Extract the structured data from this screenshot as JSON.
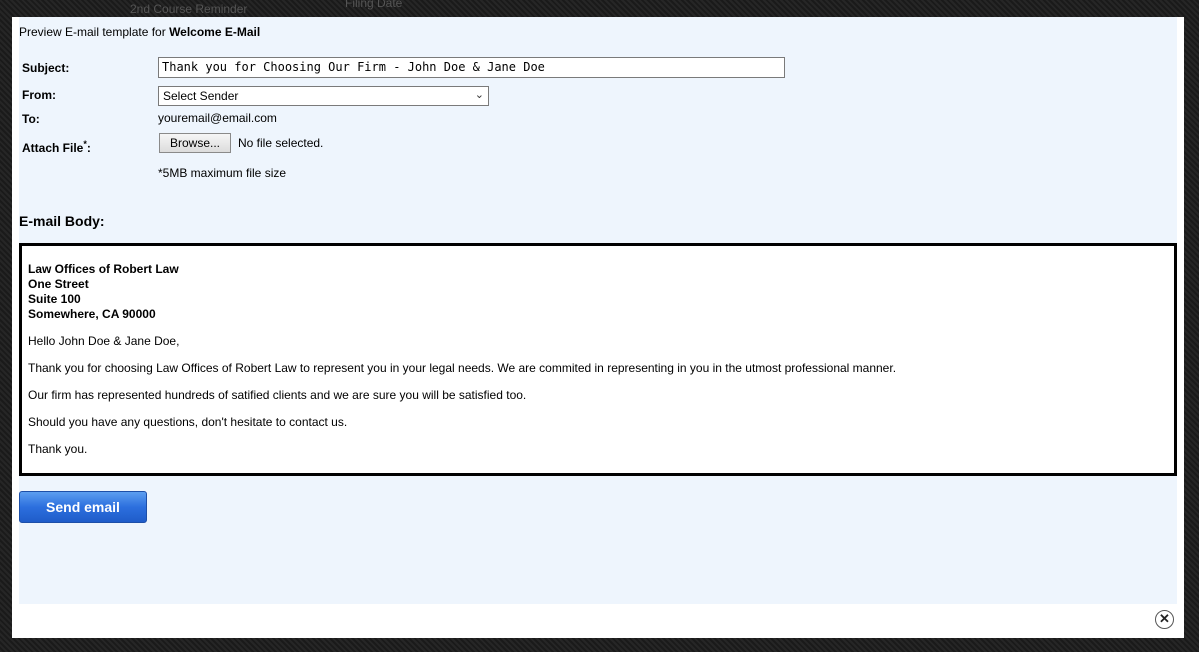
{
  "background": {
    "text_left": "2nd Course Reminder",
    "text_right": "Filing Date"
  },
  "preview": {
    "prefix": "Preview E-mail template for",
    "template_name": "Welcome E-Mail"
  },
  "form": {
    "subject_label": "Subject:",
    "subject_value": "Thank you for Choosing Our Firm - John Doe & Jane Doe",
    "from_label": "From:",
    "from_value": "Select Sender",
    "to_label": "To:",
    "to_value": "youremail@email.com",
    "attach_label": "Attach File",
    "attach_required": "*",
    "attach_colon": ":",
    "browse_label": "Browse...",
    "no_file_text": "No file selected.",
    "size_note": "*5MB maximum file size"
  },
  "body": {
    "heading": "E-mail Body:",
    "address": [
      "Law Offices of Robert Law",
      "One Street",
      "Suite 100",
      "Somewhere, CA 90000"
    ],
    "paragraphs": [
      "Hello John Doe & Jane Doe,",
      "Thank you for choosing Law Offices of Robert Law to represent you in your legal needs. We are commited in representing in you in the utmost professional manner.",
      "Our firm has represented hundreds of satified clients and we are sure you will be satisfied too.",
      "Should you have any questions, don't hesitate to contact us.",
      "Thank you."
    ]
  },
  "actions": {
    "send_label": "Send email",
    "close_symbol": "✕"
  },
  "colors": {
    "panel_bg": "#eef5fd",
    "send_button": "#2c6fde"
  }
}
